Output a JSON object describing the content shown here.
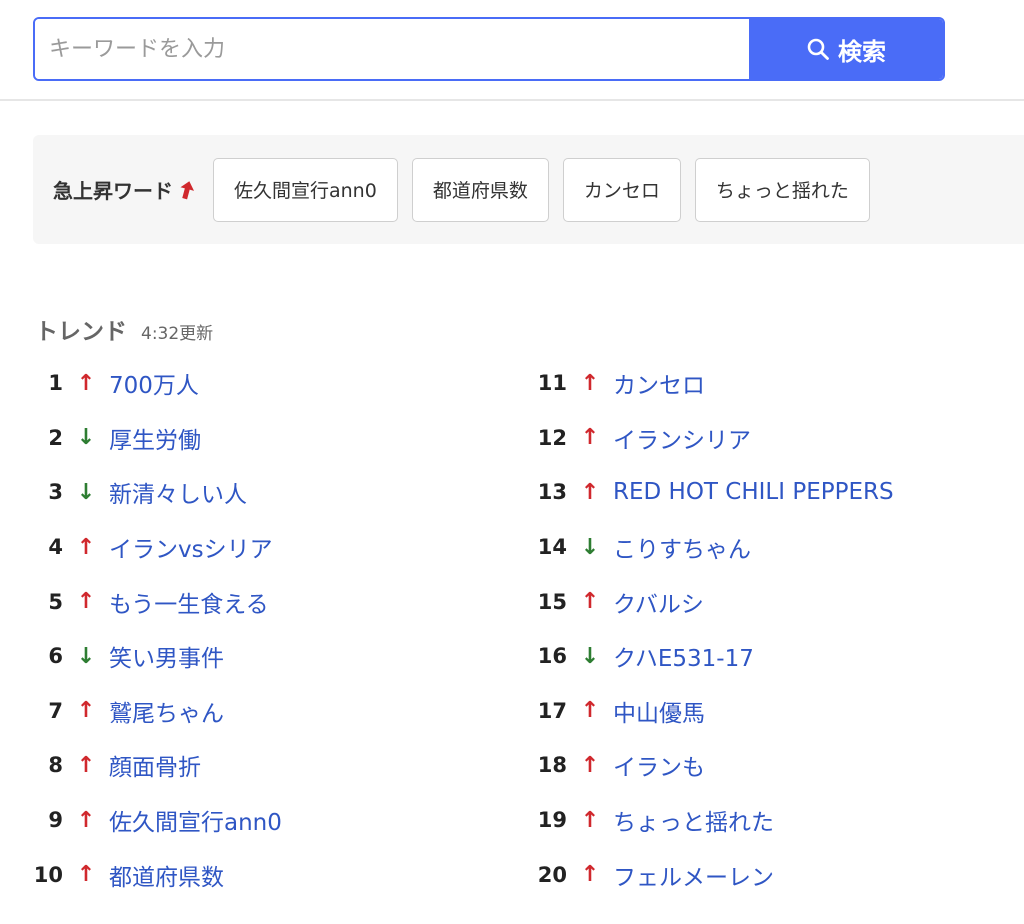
{
  "search": {
    "placeholder": "キーワードを入力",
    "value": "",
    "button_label": "検索"
  },
  "rising": {
    "label": "急上昇ワード",
    "chips": [
      "佐久間宣行ann0",
      "都道府県数",
      "カンセロ",
      "ちょっと揺れた"
    ]
  },
  "trend": {
    "title": "トレンド",
    "updated": "4:32更新",
    "left": [
      {
        "rank": "1",
        "dir": "up",
        "arrow": "↑",
        "word": "700万人"
      },
      {
        "rank": "2",
        "dir": "down",
        "arrow": "↓",
        "word": "厚生労働"
      },
      {
        "rank": "3",
        "dir": "down",
        "arrow": "↓",
        "word": "新清々しい人"
      },
      {
        "rank": "4",
        "dir": "up",
        "arrow": "↑",
        "word": "イランvsシリア"
      },
      {
        "rank": "5",
        "dir": "up",
        "arrow": "↑",
        "word": "もう一生食える"
      },
      {
        "rank": "6",
        "dir": "down",
        "arrow": "↓",
        "word": "笑い男事件"
      },
      {
        "rank": "7",
        "dir": "up",
        "arrow": "↑",
        "word": "鷲尾ちゃん"
      },
      {
        "rank": "8",
        "dir": "up",
        "arrow": "↑",
        "word": "顔面骨折"
      },
      {
        "rank": "9",
        "dir": "up",
        "arrow": "↑",
        "word": "佐久間宣行ann0"
      },
      {
        "rank": "10",
        "dir": "up",
        "arrow": "↑",
        "word": "都道府県数"
      }
    ],
    "right": [
      {
        "rank": "11",
        "dir": "up",
        "arrow": "↑",
        "word": "カンセロ"
      },
      {
        "rank": "12",
        "dir": "up",
        "arrow": "↑",
        "word": "イランシリア"
      },
      {
        "rank": "13",
        "dir": "up",
        "arrow": "↑",
        "word": "RED HOT CHILI PEPPERS"
      },
      {
        "rank": "14",
        "dir": "down",
        "arrow": "↓",
        "word": "こりすちゃん"
      },
      {
        "rank": "15",
        "dir": "up",
        "arrow": "↑",
        "word": "クバルシ"
      },
      {
        "rank": "16",
        "dir": "down",
        "arrow": "↓",
        "word": "クハE531-17"
      },
      {
        "rank": "17",
        "dir": "up",
        "arrow": "↑",
        "word": "中山優馬"
      },
      {
        "rank": "18",
        "dir": "up",
        "arrow": "↑",
        "word": "イランも"
      },
      {
        "rank": "19",
        "dir": "up",
        "arrow": "↑",
        "word": "ちょっと揺れた"
      },
      {
        "rank": "20",
        "dir": "up",
        "arrow": "↑",
        "word": "フェルメーレン"
      }
    ]
  },
  "colors": {
    "accent": "#4a6cf7",
    "up": "#d0282d",
    "down": "#2e7d32",
    "link": "#2f56c4"
  }
}
